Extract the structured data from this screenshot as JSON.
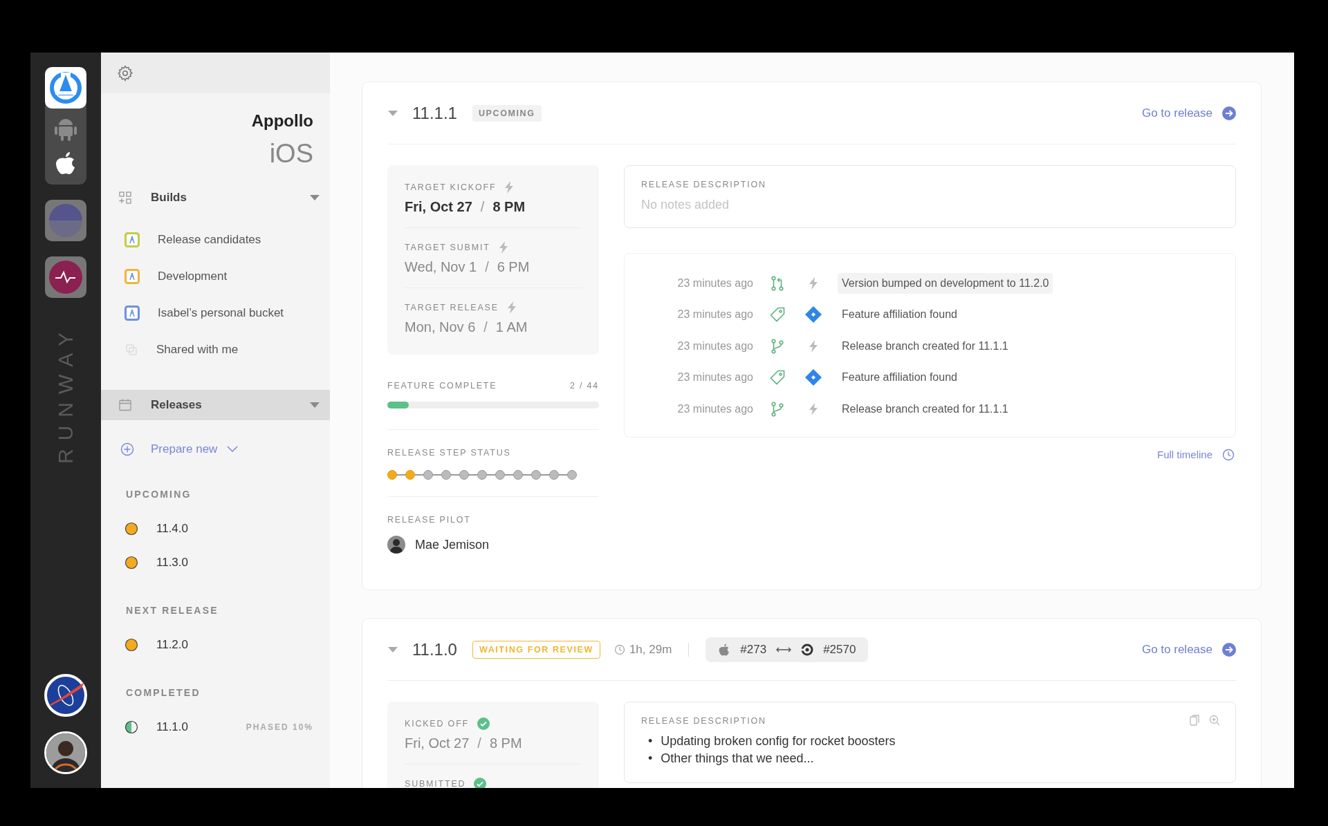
{
  "rail": {
    "brand_label": "RUNWAY",
    "platforms": [
      {
        "kind": "android",
        "selected": false
      },
      {
        "kind": "apple",
        "selected": true
      }
    ]
  },
  "sidebar": {
    "app_name": "Appollo",
    "platform": "iOS",
    "sections": [
      {
        "label": "Builds",
        "kind": "builds",
        "selected": false,
        "expanded": true,
        "items": [
          {
            "label": "Release candidates",
            "kind": "bucket",
            "color": "#c4cc45"
          },
          {
            "label": "Development",
            "kind": "bucket",
            "color": "#f0b43a"
          },
          {
            "label": "Isabel’s personal bucket",
            "kind": "bucket",
            "color": "#6f90e0"
          },
          {
            "label": "Shared with me",
            "kind": "shared"
          }
        ]
      },
      {
        "label": "Releases",
        "kind": "releases",
        "selected": true,
        "expanded": true
      }
    ],
    "prepare_new": "Prepare new",
    "release_groups": [
      {
        "title": "UPCOMING",
        "releases": [
          {
            "version": "11.4.0",
            "kind": "full",
            "color": "#f5a91d"
          },
          {
            "version": "11.3.0",
            "kind": "full",
            "color": "#f5a91d"
          }
        ]
      },
      {
        "title": "NEXT RELEASE",
        "releases": [
          {
            "version": "11.2.0",
            "kind": "full",
            "color": "#f5a91d"
          }
        ]
      },
      {
        "title": "COMPLETED",
        "releases": [
          {
            "version": "11.1.0",
            "kind": "half",
            "color": "#5cc08a",
            "note": "PHASED 10%"
          }
        ]
      }
    ]
  },
  "releases": [
    {
      "version": "11.1.1",
      "expanded": true,
      "badge": {
        "label": "UPCOMING",
        "kind": "neutral"
      },
      "link": "Go to release",
      "milestones": [
        {
          "label": "TARGET KICKOFF",
          "kind": "bolt",
          "date": "Fri, Oct 27",
          "separator": "/",
          "time": "8 PM",
          "current": true
        },
        {
          "label": "TARGET SUBMIT",
          "kind": "bolt",
          "date": "Wed, Nov 1",
          "separator": "/",
          "time": "6 PM",
          "current": false
        },
        {
          "label": "TARGET RELEASE",
          "kind": "bolt",
          "date": "Mon, Nov 6",
          "separator": "/",
          "time": "1 AM",
          "current": false
        }
      ],
      "feature_complete": {
        "label": "FEATURE COMPLETE",
        "count": "2 / 44",
        "level": 0.1
      },
      "step_status": {
        "label": "RELEASE STEP STATUS",
        "steps": [
          {
            "done": true
          },
          {
            "done": true
          },
          {
            "done": false
          },
          {
            "done": false
          },
          {
            "done": false
          },
          {
            "done": false
          },
          {
            "done": false
          },
          {
            "done": false
          },
          {
            "done": false
          },
          {
            "done": false
          },
          {
            "done": false
          }
        ]
      },
      "pilot": {
        "label": "RELEASE PILOT",
        "name": "Mae Jemison"
      },
      "description": {
        "label": "RELEASE DESCRIPTION",
        "empty_text": "No notes added"
      },
      "timeline": [
        {
          "time": "23 minutes ago",
          "kind": "pull-request",
          "source": {
            "kind": "bolt"
          },
          "text": "Version bumped on development to 11.2.0",
          "highlighted": true
        },
        {
          "time": "23 minutes ago",
          "kind": "tag",
          "source": {
            "kind": "diamond"
          },
          "text": "Feature affiliation found",
          "highlighted": false
        },
        {
          "time": "23 minutes ago",
          "kind": "branch",
          "source": {
            "kind": "bolt"
          },
          "text": "Release branch created for 11.1.1",
          "highlighted": false
        },
        {
          "time": "23 minutes ago",
          "kind": "tag",
          "source": {
            "kind": "diamond"
          },
          "text": "Feature affiliation found",
          "highlighted": false
        },
        {
          "time": "23 minutes ago",
          "kind": "branch",
          "source": {
            "kind": "bolt"
          },
          "text": "Release branch created for 11.1.1",
          "highlighted": false
        }
      ],
      "full_timeline": "Full timeline"
    },
    {
      "version": "11.1.0",
      "expanded": true,
      "badge": {
        "label": "WAITING FOR REVIEW",
        "kind": "warning"
      },
      "duration": "1h, 29m",
      "builds": {
        "from": "#273",
        "to": "#2570"
      },
      "link": "Go to release",
      "milestones": [
        {
          "label": "KICKED OFF",
          "kind": "check",
          "date": "Fri, Oct 27",
          "separator": "/",
          "time": "8 PM",
          "current": false
        },
        {
          "label": "SUBMITTED",
          "kind": "check"
        }
      ],
      "description": {
        "label": "RELEASE DESCRIPTION",
        "bullet": "•",
        "bullets": [
          "Updating broken config for rocket boosters",
          "Other things that we need..."
        ]
      }
    }
  ]
}
